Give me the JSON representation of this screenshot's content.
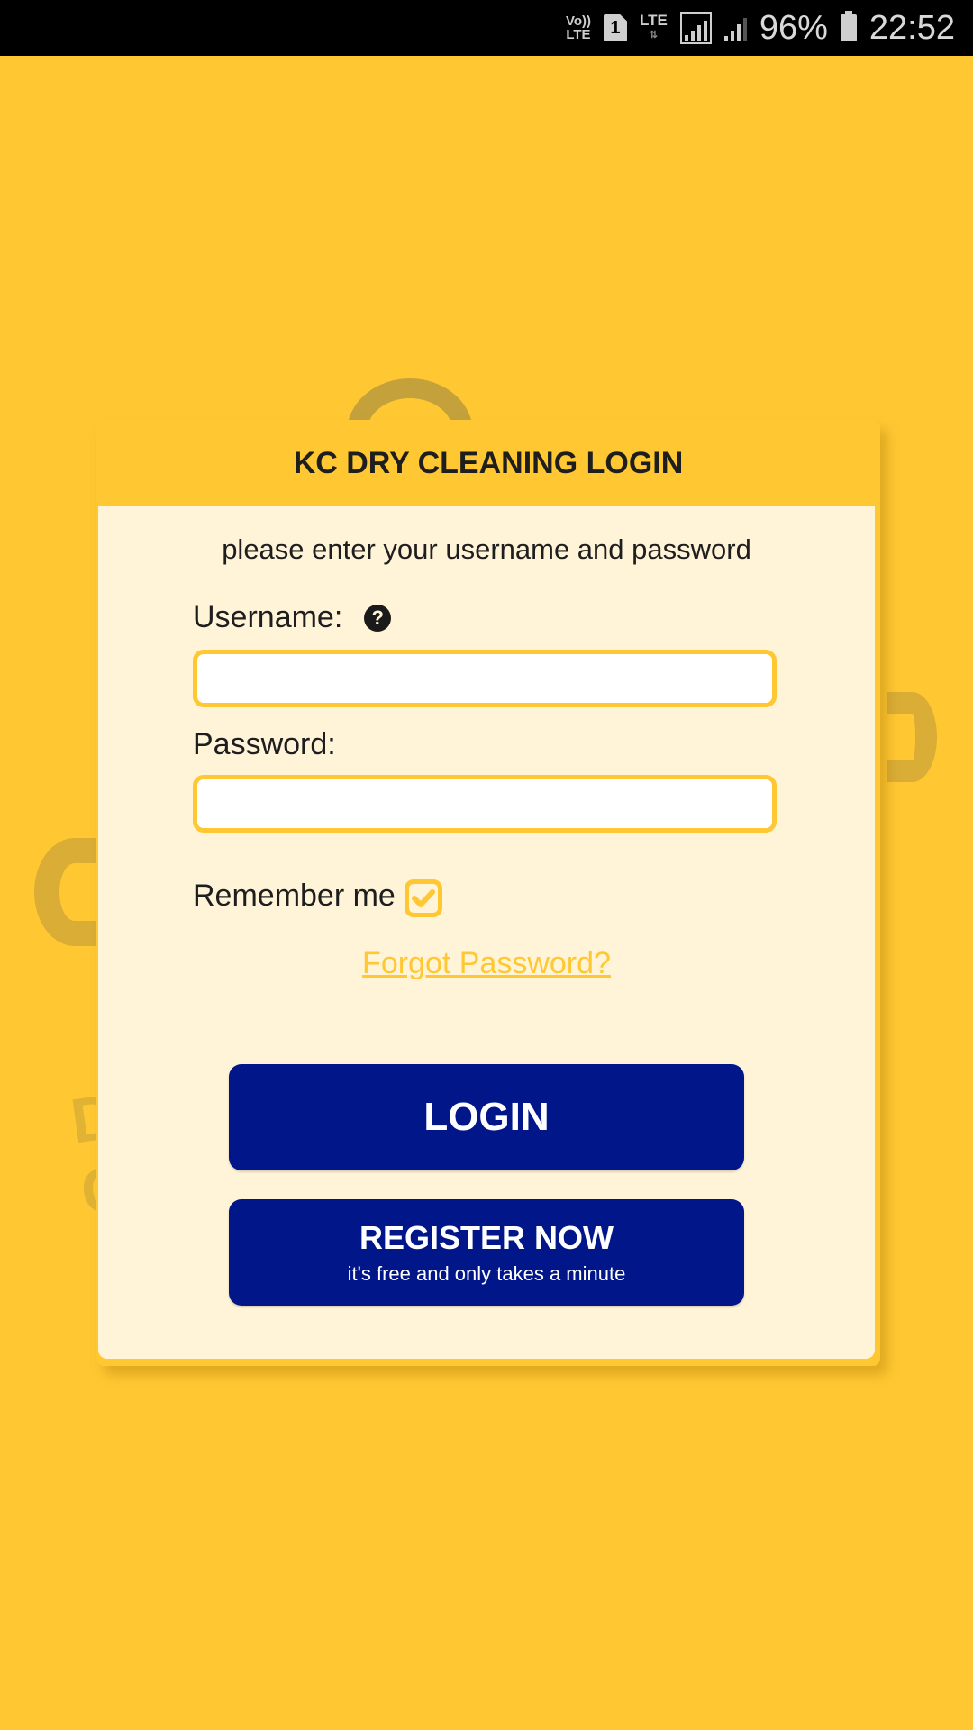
{
  "status_bar": {
    "volte": [
      "Vo))",
      "LTE"
    ],
    "sim_slot": "1",
    "network": "LTE",
    "battery_percent": "96%",
    "time": "22:52"
  },
  "colors": {
    "background": "#FFC832",
    "card_body": "#FFF4D8",
    "button": "#001689",
    "link": "#FFC832"
  },
  "watermark": {
    "line1": "DRY CLEANING",
    "letter_g": "G"
  },
  "login_card": {
    "title": "KC DRY CLEANING LOGIN",
    "intro": "please enter your username and password",
    "username_label": "Username:",
    "username_value": "",
    "help_icon": "question-circle-icon",
    "password_label": "Password:",
    "password_value": "",
    "remember_label": "Remember me",
    "remember_checked": true,
    "forgot_link": "Forgot Password?",
    "login_button": "LOGIN",
    "register_button": "REGISTER NOW",
    "register_subtext": "it's free and only takes a minute"
  }
}
